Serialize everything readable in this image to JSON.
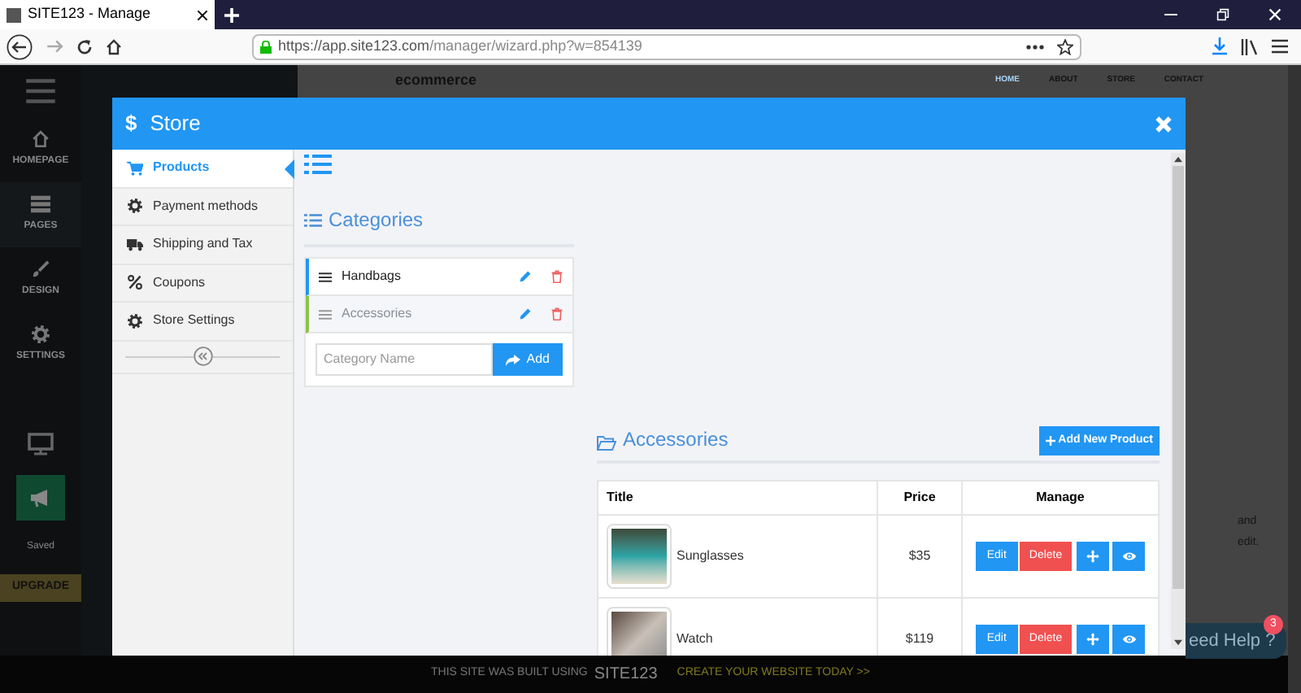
{
  "browser": {
    "tab_title": "SITE123 - Manage",
    "url_host": "https://app.site123.com",
    "url_path": "/manager/wizard.php?w=854139"
  },
  "background": {
    "sidebar": [
      {
        "label": "HOMEPAGE"
      },
      {
        "label": "PAGES"
      },
      {
        "label": "DESIGN"
      },
      {
        "label": "SETTINGS"
      }
    ],
    "saved": "Saved",
    "upgrade": "UPGRADE",
    "site_title": "ecommerce",
    "nav": [
      {
        "label": "HOME",
        "selected": true
      },
      {
        "label": "ABOUT",
        "selected": false
      },
      {
        "label": "STORE",
        "selected": false
      },
      {
        "label": "CONTACT",
        "selected": false
      }
    ],
    "side_text": [
      "and",
      "edit."
    ],
    "help": "eed Help ?",
    "help_badge": "3",
    "footer": {
      "text": "THIS SITE WAS BUILT USING",
      "brand": "SITE123",
      "cta": "CREATE YOUR WEBSITE TODAY >>"
    }
  },
  "modal": {
    "currency_symbol": "$",
    "title": "Store",
    "nav": [
      {
        "label": "Products",
        "selected": true
      },
      {
        "label": "Payment methods",
        "selected": false
      },
      {
        "label": "Shipping and Tax",
        "selected": false
      },
      {
        "label": "Coupons",
        "selected": false
      },
      {
        "label": "Store Settings",
        "selected": false
      }
    ],
    "categories_title": "Categories",
    "categories": [
      {
        "name": "Handbags",
        "selected": false
      },
      {
        "name": "Accessories",
        "selected": true
      }
    ],
    "category_placeholder": "Category Name",
    "add_button": "Add",
    "products_title": "Accessories",
    "add_product_button": "Add New Product",
    "columns": [
      "Title",
      "Price",
      "Manage"
    ],
    "rows": [
      {
        "title": "Sunglasses",
        "price": "$35",
        "edit": "Edit",
        "delete": "Delete"
      },
      {
        "title": "Watch",
        "price": "$119",
        "edit": "Edit",
        "delete": "Delete"
      }
    ]
  }
}
